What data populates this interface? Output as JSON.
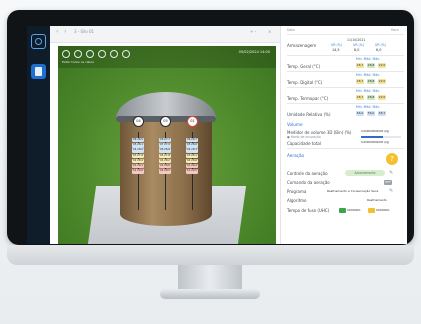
{
  "tabs": {
    "title": "3 - Silo 01",
    "nav_prev": "‹",
    "nav_next": "›",
    "zoom": "+ -",
    "close": "×"
  },
  "viewer": {
    "tool_label": "Exibir todos os cabos",
    "timestamp": "05/02/2024 14:00",
    "nodes": [
      "04",
      "05",
      "01"
    ],
    "sensors": [
      [
        "06 28.5",
        "05 28.1",
        "04 28.0",
        "03 27.9",
        "02 28.4",
        "01 29.1",
        "S1 29.0"
      ],
      [
        "08 27.7",
        "07 27.9",
        "06 28.6",
        "05 27.8",
        "04 28.2",
        "03 28.6",
        "02 28.5"
      ],
      [
        "06 28.7",
        "05 28.0",
        "04 28.3",
        "03 28.1",
        "02 28.6",
        "01 29.2",
        "S1 29.5"
      ]
    ]
  },
  "panel": {
    "hdr_left": "Data",
    "hdr_right": "Hora",
    "date": "11/10/2021",
    "armazenagem": "Armazenagem",
    "arm_cols": [
      "UR (%)",
      "UR (%)",
      "UR (%)"
    ],
    "arm_vals": [
      "14,5",
      "8,0",
      "6,0"
    ],
    "rows": [
      {
        "label": "Temp. Geral (°C)",
        "mins": "Min.  Méd.  Máx.",
        "vals": [
          "28,7",
          "28,8",
          "29,5"
        ]
      },
      {
        "label": "Temp. Digital (°C)",
        "mins": "Min.  Méd.  Máx.",
        "vals": [
          "28,7",
          "28,8",
          "29,5"
        ]
      },
      {
        "label": "Temp. Termopar (°C)",
        "mins": "Min.  Méd.  Máx.",
        "vals": [
          "28,7",
          "28,8",
          "29,5"
        ]
      },
      {
        "label": "Umidade Relativa (%)",
        "mins": "Min.  Méd.  Máx.",
        "vals": [
          "56,0",
          "56,0",
          "58,7"
        ]
      }
    ],
    "volume_section": "Volume",
    "volume_label": "Medidor de volume 3D (Bin) (%)",
    "volume_sub": "● Modo de ocupação",
    "volume_value": "0,000000000000 (kg)",
    "volume_pct": 0.55,
    "capacity_label": "Capacidade total",
    "capacity_value": "0,000000000000 (kg)",
    "aeration_section": "Aeração",
    "rows2": [
      {
        "label": "Controle da aeração",
        "value": "Acionamento"
      },
      {
        "label": "Comando da aeração",
        "value": "OFF"
      },
      {
        "label": "Programa",
        "value": "Resfriamento e Conservação Seca"
      },
      {
        "label": "Algoritmo",
        "value": "Resfriamento"
      }
    ],
    "footer_label": "Tempo de fuso (UHC)",
    "footer_v1": "0000000",
    "footer_v2": "0000000"
  }
}
